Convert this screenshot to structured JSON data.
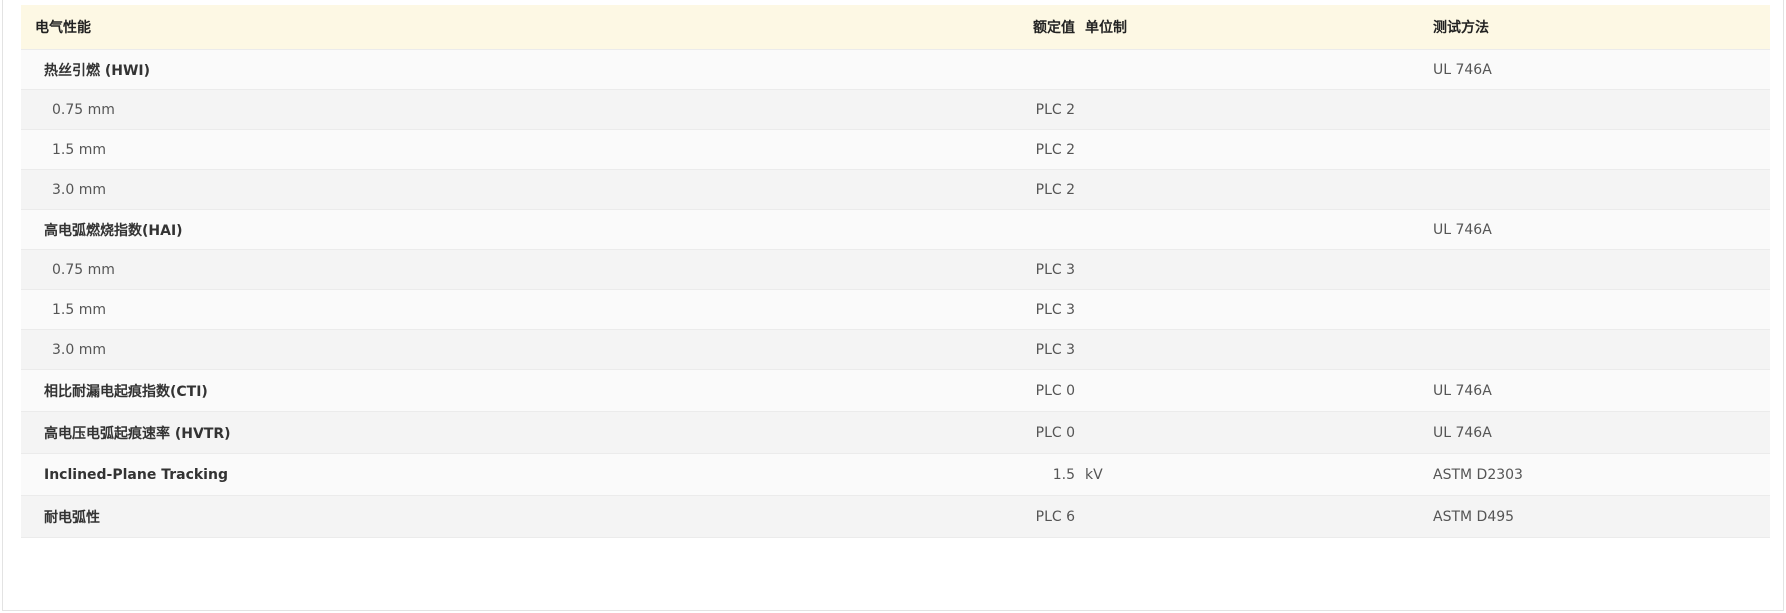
{
  "table": {
    "headers": {
      "property": "电气性能",
      "rated_value": "额定值",
      "unit": "单位制",
      "test_method": "测试方法"
    },
    "rows": [
      {
        "name": "热丝引燃 (HWI)",
        "kind": "main",
        "value": "",
        "unit": "",
        "method": "UL 746A"
      },
      {
        "name": "0.75 mm",
        "kind": "sub",
        "value": "PLC 2",
        "unit": "",
        "method": ""
      },
      {
        "name": "1.5 mm",
        "kind": "sub",
        "value": "PLC 2",
        "unit": "",
        "method": ""
      },
      {
        "name": "3.0 mm",
        "kind": "sub",
        "value": "PLC 2",
        "unit": "",
        "method": ""
      },
      {
        "name": "高电弧燃烧指数(HAI)",
        "kind": "main",
        "value": "",
        "unit": "",
        "method": "UL 746A"
      },
      {
        "name": "0.75 mm",
        "kind": "sub",
        "value": "PLC 3",
        "unit": "",
        "method": ""
      },
      {
        "name": "1.5 mm",
        "kind": "sub",
        "value": "PLC 3",
        "unit": "",
        "method": ""
      },
      {
        "name": "3.0 mm",
        "kind": "sub",
        "value": "PLC 3",
        "unit": "",
        "method": ""
      },
      {
        "name": "相比耐漏电起痕指数(CTI)",
        "kind": "main",
        "value": "PLC 0",
        "unit": "",
        "method": "UL 746A"
      },
      {
        "name": "高电压电弧起痕速率 (HVTR)",
        "kind": "main",
        "value": "PLC 0",
        "unit": "",
        "method": "UL 746A"
      },
      {
        "name": "Inclined-Plane Tracking",
        "kind": "main",
        "value": "1.5",
        "unit": "kV",
        "method": "ASTM D2303"
      },
      {
        "name": "耐电弧性",
        "kind": "main",
        "value": "PLC 6",
        "unit": "",
        "method": "ASTM D495"
      }
    ]
  }
}
